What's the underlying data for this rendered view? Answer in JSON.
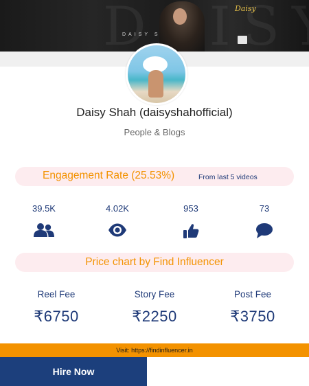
{
  "banner": {
    "name_text": "DAISY SHAH",
    "colors": {
      "background": "#1c1c1c",
      "signature": "#e8c24a"
    }
  },
  "profile": {
    "name": "Daisy Shah (daisyshahofficial)",
    "category": "People & Blogs"
  },
  "engagement": {
    "label": "Engagement Rate (25.53%)",
    "note": "From last 5 videos"
  },
  "stats": [
    {
      "value": "39.5K",
      "icon": "followers-icon"
    },
    {
      "value": "4.02K",
      "icon": "views-icon"
    },
    {
      "value": "953",
      "icon": "likes-icon"
    },
    {
      "value": "73",
      "icon": "comments-icon"
    }
  ],
  "price_chart": {
    "title": "Price chart by Find Influencer",
    "fees": [
      {
        "label": "Reel Fee",
        "amount": "₹6750"
      },
      {
        "label": "Story Fee",
        "amount": "₹2250"
      },
      {
        "label": "Post Fee",
        "amount": "₹3750"
      }
    ]
  },
  "footer": {
    "visit_text": "Visit: https://findinfluencer.in",
    "hire_label": "Hire Now"
  },
  "colors": {
    "accent": "#f39200",
    "primary": "#1f3a78",
    "pill_bg": "#fdecef",
    "button_bg": "#1c3f7c"
  }
}
